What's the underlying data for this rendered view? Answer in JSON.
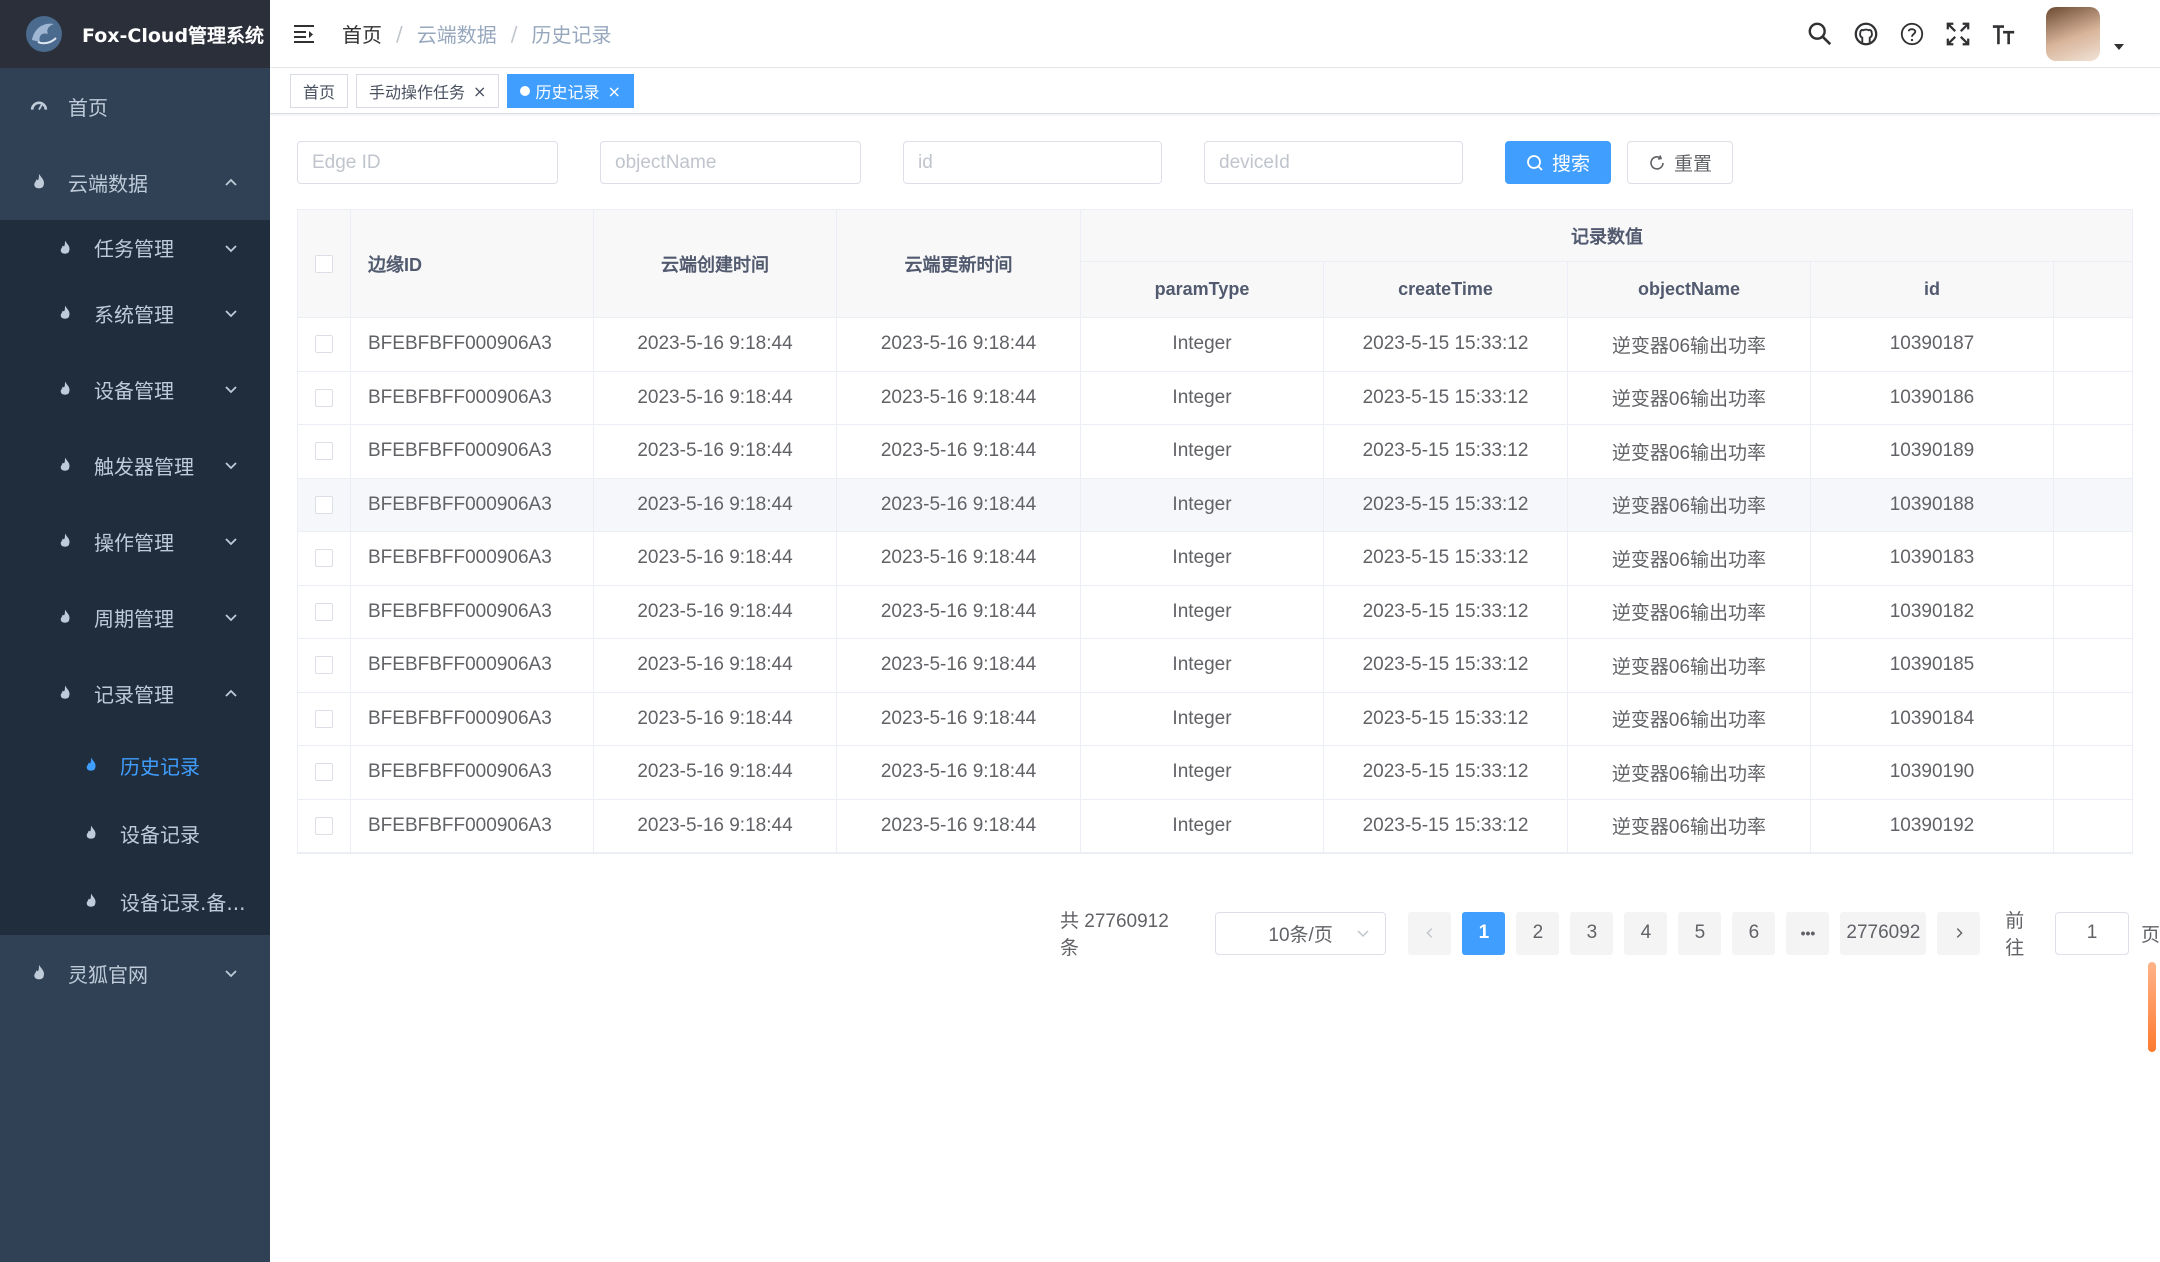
{
  "app": {
    "title": "Fox-Cloud管理系统"
  },
  "sidebar": {
    "items": [
      {
        "label": "首页"
      },
      {
        "label": "云端数据"
      },
      {
        "label": "任务管理"
      },
      {
        "label": "系统管理"
      },
      {
        "label": "设备管理"
      },
      {
        "label": "触发器管理"
      },
      {
        "label": "操作管理"
      },
      {
        "label": "周期管理"
      },
      {
        "label": "记录管理"
      },
      {
        "label": "历史记录"
      },
      {
        "label": "设备记录"
      },
      {
        "label": "设备记录.备..."
      },
      {
        "label": "灵狐官网"
      }
    ]
  },
  "breadcrumb": [
    "首页",
    "云端数据",
    "历史记录"
  ],
  "tags": [
    "首页",
    "手动操作任务",
    "历史记录"
  ],
  "search": {
    "placeholders": [
      "Edge ID",
      "objectName",
      "id",
      "deviceId"
    ],
    "search_label": "搜索",
    "reset_label": "重置"
  },
  "table": {
    "headers": {
      "edge_id": "边缘ID",
      "create": "云端创建时间",
      "update": "云端更新时间",
      "group": "记录数值",
      "paramType": "paramType",
      "createTime": "createTime",
      "objectName": "objectName",
      "id": "id"
    },
    "rows": [
      [
        "BFEBFBFF000906A3",
        "2023-5-16 9:18:44",
        "2023-5-16 9:18:44",
        "Integer",
        "2023-5-15 15:33:12",
        "逆变器06输出功率",
        "10390187"
      ],
      [
        "BFEBFBFF000906A3",
        "2023-5-16 9:18:44",
        "2023-5-16 9:18:44",
        "Integer",
        "2023-5-15 15:33:12",
        "逆变器06输出功率",
        "10390186"
      ],
      [
        "BFEBFBFF000906A3",
        "2023-5-16 9:18:44",
        "2023-5-16 9:18:44",
        "Integer",
        "2023-5-15 15:33:12",
        "逆变器06输出功率",
        "10390189"
      ],
      [
        "BFEBFBFF000906A3",
        "2023-5-16 9:18:44",
        "2023-5-16 9:18:44",
        "Integer",
        "2023-5-15 15:33:12",
        "逆变器06输出功率",
        "10390188"
      ],
      [
        "BFEBFBFF000906A3",
        "2023-5-16 9:18:44",
        "2023-5-16 9:18:44",
        "Integer",
        "2023-5-15 15:33:12",
        "逆变器06输出功率",
        "10390183"
      ],
      [
        "BFEBFBFF000906A3",
        "2023-5-16 9:18:44",
        "2023-5-16 9:18:44",
        "Integer",
        "2023-5-15 15:33:12",
        "逆变器06输出功率",
        "10390182"
      ],
      [
        "BFEBFBFF000906A3",
        "2023-5-16 9:18:44",
        "2023-5-16 9:18:44",
        "Integer",
        "2023-5-15 15:33:12",
        "逆变器06输出功率",
        "10390185"
      ],
      [
        "BFEBFBFF000906A3",
        "2023-5-16 9:18:44",
        "2023-5-16 9:18:44",
        "Integer",
        "2023-5-15 15:33:12",
        "逆变器06输出功率",
        "10390184"
      ],
      [
        "BFEBFBFF000906A3",
        "2023-5-16 9:18:44",
        "2023-5-16 9:18:44",
        "Integer",
        "2023-5-15 15:33:12",
        "逆变器06输出功率",
        "10390190"
      ],
      [
        "BFEBFBFF000906A3",
        "2023-5-16 9:18:44",
        "2023-5-16 9:18:44",
        "Integer",
        "2023-5-15 15:33:12",
        "逆变器06输出功率",
        "10390192"
      ]
    ]
  },
  "pagination": {
    "total": "共 27760912 条",
    "page_size": "10条/页",
    "pages": [
      "1",
      "2",
      "3",
      "4",
      "5",
      "6"
    ],
    "ellipsis": "•••",
    "last": "2776092",
    "goto_label": "前往",
    "goto_value": "1",
    "page_unit": "页"
  },
  "colors": {
    "sidebar": "#304156",
    "primary": "#409eff"
  }
}
